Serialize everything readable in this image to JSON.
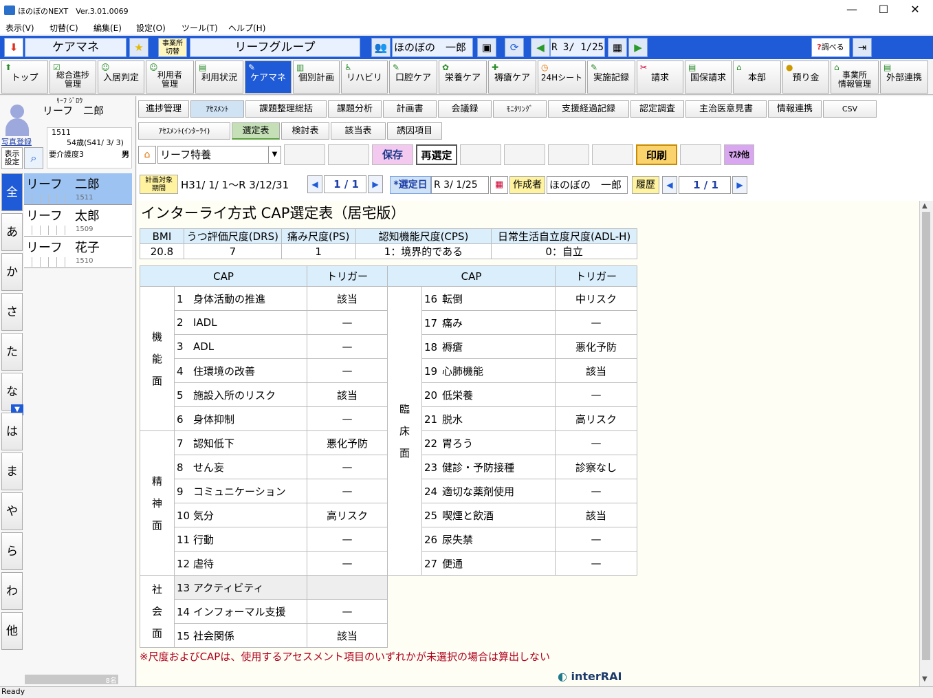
{
  "titlebar": {
    "title": "ほのぼのNEXT　Ver.3.01.0069",
    "minimize": "—",
    "maximize": "☐",
    "close": "✕"
  },
  "menu": [
    "表示(V)",
    "切替(C)",
    "編集(E)",
    "設定(O)",
    "ツール(T)",
    "ヘルプ(H)"
  ],
  "banner": {
    "module": "ケアマネ",
    "switch_office": "事業所\n切替",
    "group": "リーフグループ",
    "user": "ほのぼの　一郎",
    "date": "R 3/ 1/25",
    "search": "調べる"
  },
  "nav": [
    {
      "label": "トップ"
    },
    {
      "label": "総合進捗\n管理"
    },
    {
      "label": "入居判定"
    },
    {
      "label": "利用者\n管理"
    },
    {
      "label": "利用状況"
    },
    {
      "label": "ケアマネ"
    },
    {
      "label": "個別計画"
    },
    {
      "label": "リハビリ"
    },
    {
      "label": "口腔ケア"
    },
    {
      "label": "栄養ケア"
    },
    {
      "label": "褥瘡ケア"
    },
    {
      "label": "24Hシート"
    },
    {
      "label": "実施記録"
    },
    {
      "label": "請求"
    },
    {
      "label": "国保請求"
    },
    {
      "label": "本部"
    },
    {
      "label": "預り金"
    },
    {
      "label": "事業所\n情報管理"
    },
    {
      "label": "外部連携"
    }
  ],
  "patient": {
    "kana": "ﾘｰﾌ ｼﾞﾛｳ",
    "name": "リーフ　二郎",
    "photo_link": "写真登録",
    "display_settings": "表示\n設定",
    "id": "1511",
    "age": "54歳(S41/ 3/ 3)",
    "care_level": "要介護度3",
    "sex": "男"
  },
  "kana_index": [
    "全",
    "あ",
    "か",
    "さ",
    "た",
    "な",
    "は",
    "ま",
    "や",
    "ら",
    "わ",
    "他"
  ],
  "patient_list": [
    {
      "name": "リーフ　二郎",
      "id": "1511"
    },
    {
      "name": "リーフ　太郎",
      "id": "1509"
    },
    {
      "name": "リーフ　花子",
      "id": "1510"
    }
  ],
  "list_footer": "8名",
  "tabs": [
    "進捗管理",
    "ｱｾｽﾒﾝﾄ",
    "課題整理総括",
    "課題分析",
    "計画書",
    "会議録",
    "ﾓﾆﾀﾘﾝｸﾞ",
    "支援経過記録",
    "認定調査",
    "主治医意見書",
    "情報連携",
    "CSV"
  ],
  "subtabs": [
    "ｱｾｽﾒﾝﾄ(ｲﾝﾀｰﾗｲ)",
    "選定表",
    "検討表",
    "該当表",
    "誘因項目"
  ],
  "toolbar": {
    "facility": "リーフ特養",
    "save": "保存",
    "reselect": "再選定",
    "print": "印刷",
    "master": "ﾏｽﾀ他"
  },
  "period": {
    "label": "計画対象\n期間",
    "value": "H31/ 1/ 1～R 3/12/31",
    "page": "1 / 1",
    "select_date_label": "*選定日",
    "select_date": "R 3/ 1/25",
    "creator_label": "作成者",
    "creator": "ほのぼの　一郎",
    "history": "履歴",
    "history_page": "1 / 1"
  },
  "sheet": {
    "title": "インターライ方式 CAP選定表（居宅版）",
    "scales_header": [
      "BMI",
      "うつ評価尺度(DRS)",
      "痛み尺度(PS)",
      "認知機能尺度(CPS)",
      "日常生活自立度尺度(ADL-H)"
    ],
    "scales_values": [
      "20.8",
      "7",
      "1",
      "1：境界的である",
      "0：自立"
    ],
    "cap_header": [
      "CAP",
      "トリガー",
      "CAP",
      "トリガー"
    ],
    "groups_left": [
      {
        "label": "機能面",
        "items": [
          {
            "no": "1",
            "name": "身体活動の推進",
            "trigger": "該当"
          },
          {
            "no": "2",
            "name": "IADL",
            "trigger": "—"
          },
          {
            "no": "3",
            "name": "ADL",
            "trigger": "—"
          },
          {
            "no": "4",
            "name": "住環境の改善",
            "trigger": "—"
          },
          {
            "no": "5",
            "name": "施設入所のリスク",
            "trigger": "該当"
          },
          {
            "no": "6",
            "name": "身体抑制",
            "trigger": "—"
          }
        ]
      },
      {
        "label": "精神面",
        "items": [
          {
            "no": "7",
            "name": "認知低下",
            "trigger": "悪化予防"
          },
          {
            "no": "8",
            "name": "せん妄",
            "trigger": "—"
          },
          {
            "no": "9",
            "name": "コミュニケーション",
            "trigger": "—"
          },
          {
            "no": "10",
            "name": "気分",
            "trigger": "高リスク"
          },
          {
            "no": "11",
            "name": "行動",
            "trigger": "—"
          },
          {
            "no": "12",
            "name": "虐待",
            "trigger": "—"
          }
        ]
      },
      {
        "label": "社会面",
        "items": [
          {
            "no": "13",
            "name": "アクティビティ",
            "trigger": ""
          },
          {
            "no": "14",
            "name": "インフォーマル支援",
            "trigger": "—"
          },
          {
            "no": "15",
            "name": "社会関係",
            "trigger": "該当"
          }
        ]
      }
    ],
    "group_right": {
      "label": "臨床面",
      "items": [
        {
          "no": "16",
          "name": "転倒",
          "trigger": "中リスク"
        },
        {
          "no": "17",
          "name": "痛み",
          "trigger": "—"
        },
        {
          "no": "18",
          "name": "褥瘡",
          "trigger": "悪化予防"
        },
        {
          "no": "19",
          "name": "心肺機能",
          "trigger": "該当"
        },
        {
          "no": "20",
          "name": "低栄養",
          "trigger": "—"
        },
        {
          "no": "21",
          "name": "脱水",
          "trigger": "高リスク"
        },
        {
          "no": "22",
          "name": "胃ろう",
          "trigger": "—"
        },
        {
          "no": "23",
          "name": "健診・予防接種",
          "trigger": "診察なし"
        },
        {
          "no": "24",
          "name": "適切な薬剤使用",
          "trigger": "—"
        },
        {
          "no": "25",
          "name": "喫煙と飲酒",
          "trigger": "該当"
        },
        {
          "no": "26",
          "name": "尿失禁",
          "trigger": "—"
        },
        {
          "no": "27",
          "name": "便通",
          "trigger": "—"
        }
      ]
    },
    "note": "※尺度およびCAPは、使用するアセスメント項目のいずれかが未選択の場合は算出しない",
    "logo": "interRAI"
  },
  "status": "Ready",
  "colors": {
    "banner": "#1f5bd6",
    "note": "#b0001a",
    "header_cell": "#dbeefb"
  }
}
